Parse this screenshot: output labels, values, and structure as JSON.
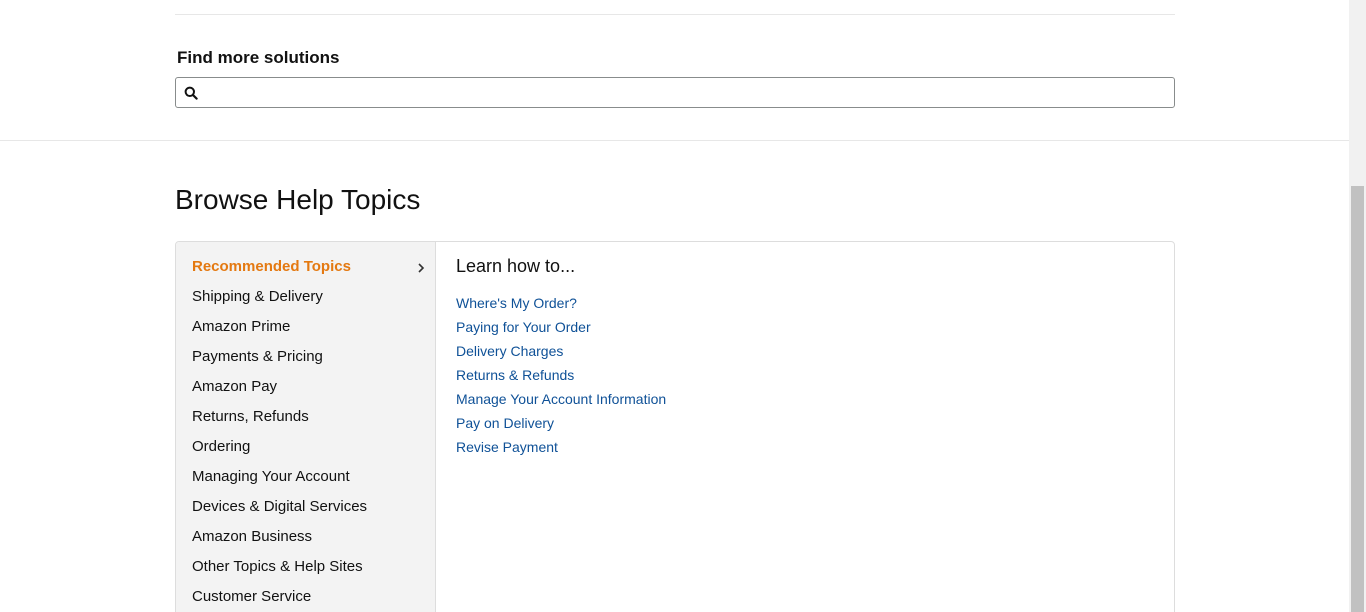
{
  "find_more": {
    "title": "Find more solutions",
    "search_placeholder": "",
    "search_value": ""
  },
  "browse": {
    "title": "Browse Help Topics",
    "nav_items": [
      {
        "label": "Recommended Topics",
        "active": true
      },
      {
        "label": "Shipping & Delivery"
      },
      {
        "label": "Amazon Prime"
      },
      {
        "label": "Payments & Pricing"
      },
      {
        "label": "Amazon Pay"
      },
      {
        "label": "Returns, Refunds"
      },
      {
        "label": "Ordering"
      },
      {
        "label": "Managing Your Account"
      },
      {
        "label": "Devices & Digital Services"
      },
      {
        "label": "Amazon Business"
      },
      {
        "label": "Other Topics & Help Sites"
      },
      {
        "label": "Customer Service"
      }
    ],
    "learn": {
      "title": "Learn how to...",
      "links": [
        "Where's My Order?",
        "Paying for Your Order",
        "Delivery Charges",
        "Returns & Refunds",
        "Manage Your Account Information",
        "Pay on Delivery",
        "Revise Payment"
      ]
    }
  },
  "colors": {
    "active_topic": "#e47911",
    "link": "#0f5197",
    "nav_background": "#f3f3f3"
  },
  "icons": {
    "search": "search-icon",
    "chevron": "chevron-right-icon"
  }
}
